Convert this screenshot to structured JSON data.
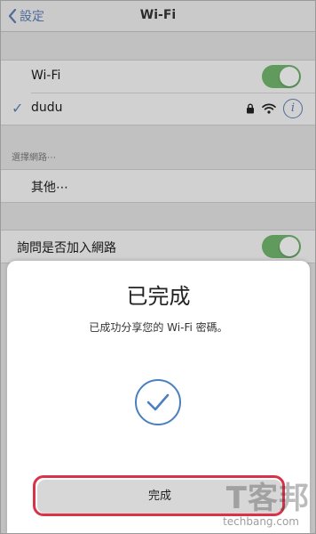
{
  "navbar": {
    "back_label": "設定",
    "title": "Wi-Fi"
  },
  "wifi": {
    "toggle_label": "Wi-Fi",
    "toggle_on": true,
    "connected_network": "dudu"
  },
  "networks_section": {
    "header": "選擇網路⋯",
    "other_label": "其他⋯"
  },
  "ask_join": {
    "label": "詢問是否加入網路",
    "toggle_on": true
  },
  "modal": {
    "title": "已完成",
    "message": "已成功分享您的 Wi-Fi 密碼。",
    "done_button": "完成"
  },
  "watermark": {
    "main": "T客邦",
    "sub": "techbang.com"
  },
  "colors": {
    "accent": "#5a7bb0",
    "toggle_on": "#6eb06a",
    "highlight": "#d93349"
  }
}
